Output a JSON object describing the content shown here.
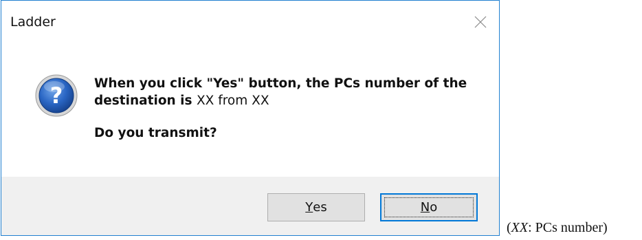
{
  "window": {
    "title": "Ladder",
    "close_icon": "close-icon"
  },
  "message": {
    "icon": "question-icon",
    "line1": "When you click \"Yes\" button, the PCs number of the",
    "line2_prefix": "destination is ",
    "line2_value1": "XX",
    "line2_mid": " from ",
    "line2_value2": "XX",
    "question": "Do you transmit?"
  },
  "buttons": {
    "yes": {
      "label": "Yes",
      "mnemonic": "Y",
      "rest": "es"
    },
    "no": {
      "label": "No",
      "mnemonic": "N",
      "rest": "o"
    }
  },
  "caption": {
    "open": "(",
    "var": "XX",
    "rest": ": PCs number)"
  },
  "colors": {
    "window_border": "#1f7fd0",
    "footer_bg": "#f0f0f0",
    "button_bg": "#e1e1e1",
    "focus_border": "#0078d7",
    "icon_blue": "#1e5fb4"
  }
}
